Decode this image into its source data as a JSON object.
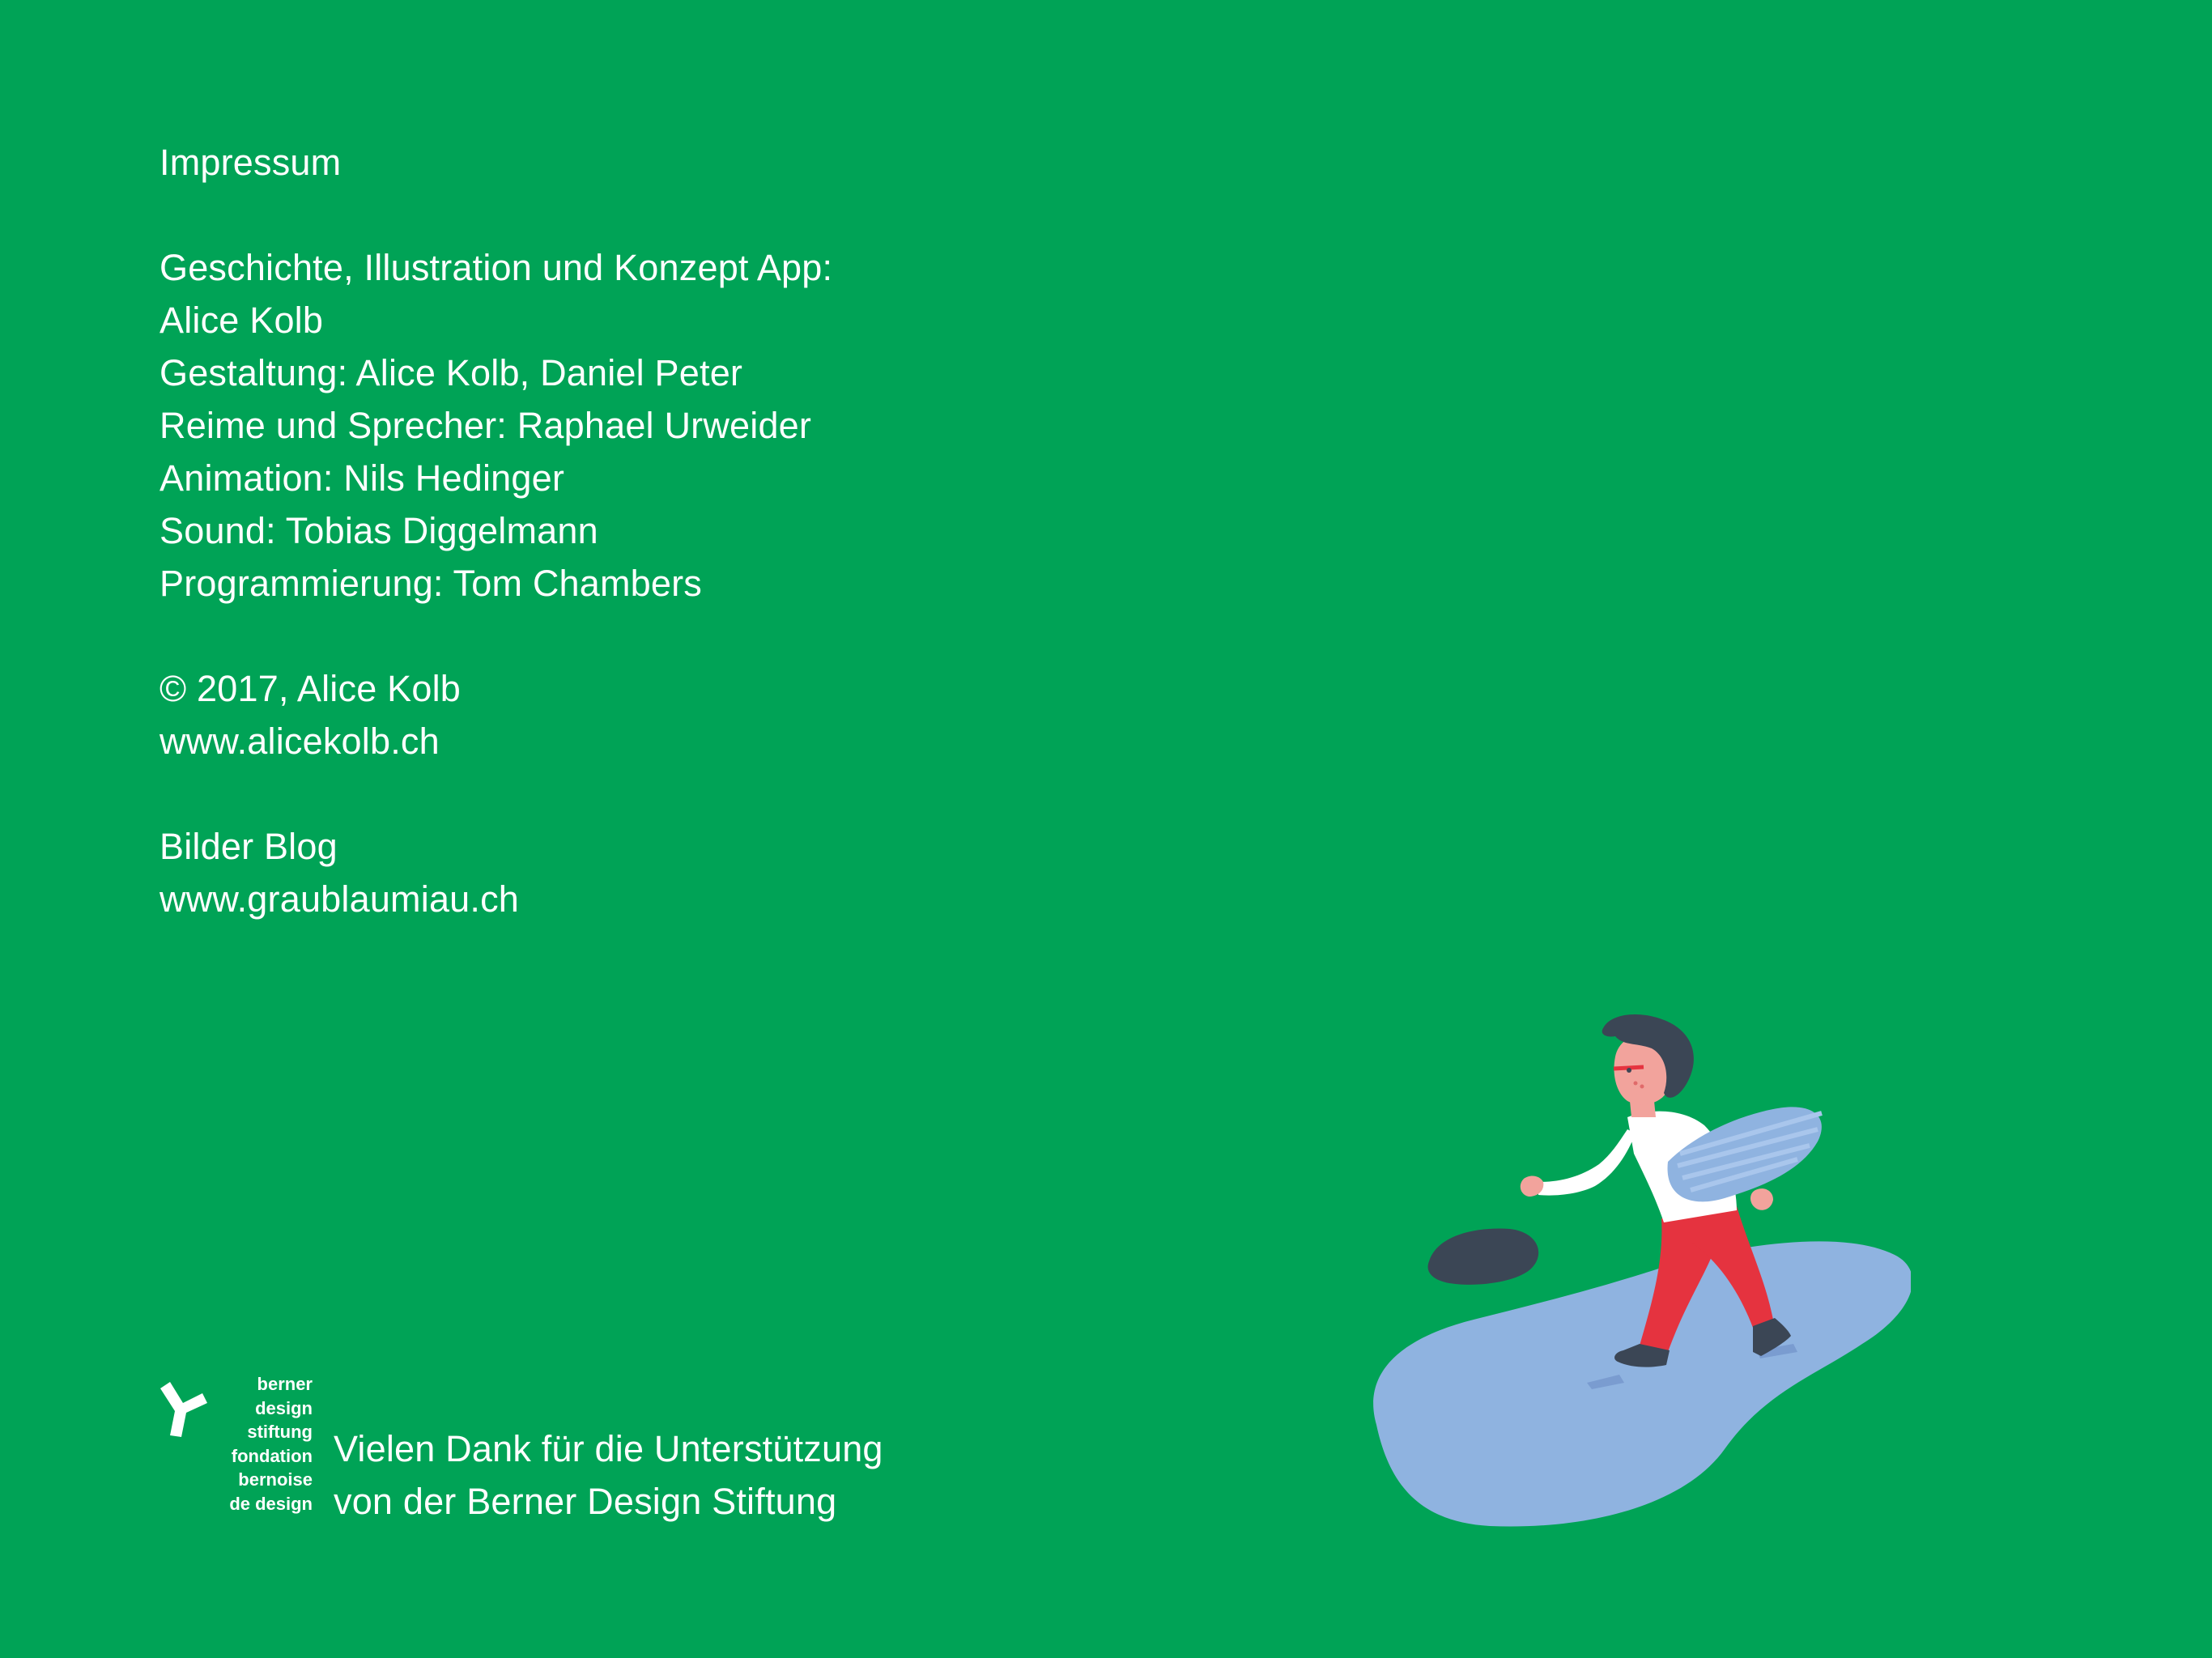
{
  "colors": {
    "background": "#00a356",
    "text": "#ffffff",
    "puddle": "#8fb3e0",
    "stone": "#3b4655",
    "pants": "#e5333f",
    "shirt": "#ffffff",
    "hair": "#3b4655",
    "skin": "#f2a39c"
  },
  "credits": {
    "heading": "Impressum",
    "concept_label": "Geschichte, Illustration und Konzept App:",
    "concept_name": "Alice Kolb",
    "design": "Gestaltung: Alice Kolb, Daniel Peter",
    "rhymes": "Reime und Sprecher: Raphael Urweider",
    "animation": "Animation: Nils Hedinger",
    "sound": "Sound: Tobias Diggelmann",
    "programming": "Programmierung: Tom Chambers",
    "copyright": "© 2017, Alice Kolb",
    "website": "www.alicekolb.ch",
    "blog_label": "Bilder Blog",
    "blog_url": "www.graublaumiau.ch"
  },
  "sponsor": {
    "logo_lines": [
      "berner",
      "design",
      "stiftung",
      "fondation",
      "bernoise",
      "de design"
    ],
    "logo_icon": "y-shape-logo-icon",
    "thanks_line1": "Vielen Dank für die Unterstützung",
    "thanks_line2": "von der Berner Design Stiftung"
  },
  "illustration": {
    "subject": "person-carrying-blue-object-walking-on-puddle"
  }
}
